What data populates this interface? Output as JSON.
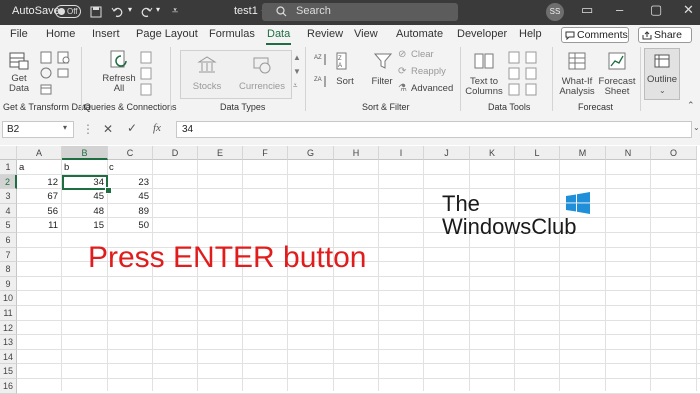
{
  "titlebar": {
    "autosave_label": "AutoSave",
    "autosave_state": "Off",
    "file_name": "test1",
    "search_placeholder": "Search",
    "user_initials": "SS"
  },
  "tabs": [
    "File",
    "Home",
    "Insert",
    "Page Layout",
    "Formulas",
    "Data",
    "Review",
    "View",
    "Automate",
    "Developer",
    "Help"
  ],
  "active_tab": "Data",
  "comments_label": "Comments",
  "share_label": "Share",
  "ribbon": {
    "get_data": "Get\nData",
    "refresh_all": "Refresh\nAll",
    "stocks": "Stocks",
    "currencies": "Currencies",
    "sort": "Sort",
    "filter": "Filter",
    "clear": "Clear",
    "reapply": "Reapply",
    "advanced": "Advanced",
    "text_to_columns": "Text to\nColumns",
    "what_if": "What-If\nAnalysis",
    "forecast_sheet": "Forecast\nSheet",
    "outline": "Outline",
    "groups": [
      "Get & Transform Data",
      "Queries & Connections",
      "Data Types",
      "Sort & Filter",
      "Data Tools",
      "Forecast"
    ]
  },
  "formula_bar": {
    "name_box": "B2",
    "formula": "34"
  },
  "columns": [
    "A",
    "B",
    "C",
    "D",
    "E",
    "F",
    "G",
    "H",
    "I",
    "J",
    "K",
    "L",
    "M",
    "N",
    "O"
  ],
  "rows": [
    "1",
    "2",
    "3",
    "4",
    "5",
    "6",
    "7",
    "8",
    "9",
    "10",
    "11",
    "12",
    "13",
    "14",
    "15",
    "16"
  ],
  "cells": {
    "header": [
      "a",
      "b",
      "c"
    ],
    "data": [
      [
        12,
        34,
        23
      ],
      [
        67,
        45,
        45
      ],
      [
        56,
        48,
        89
      ],
      [
        11,
        15,
        50
      ]
    ]
  },
  "overlay_text": "Press ENTER button",
  "watermark": {
    "line1": "The",
    "line2": "WindowsClub"
  },
  "colors": {
    "accent": "#1e6e42",
    "overlay": "#e01c1c",
    "titlebar": "#3a3a3a"
  }
}
